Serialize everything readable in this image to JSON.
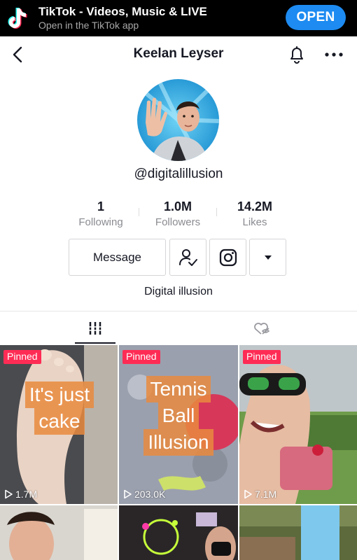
{
  "banner": {
    "title": "TikTok - Videos, Music & LIVE",
    "subtitle": "Open in the TikTok app",
    "open_label": "OPEN"
  },
  "nav": {
    "title": "Keelan Leyser",
    "icons": [
      "back-arrow-icon",
      "bell-icon",
      "more-icon"
    ]
  },
  "profile": {
    "username": "@digitalillusion",
    "bio": "Digital illusion"
  },
  "stats": [
    {
      "value": "1",
      "label": "Following"
    },
    {
      "value": "1.0M",
      "label": "Followers"
    },
    {
      "value": "14.2M",
      "label": "Likes"
    }
  ],
  "actions": {
    "message_label": "Message",
    "icons": [
      "follow-user-icon",
      "instagram-icon",
      "dropdown-caret-icon"
    ]
  },
  "tabs": [
    "videos-grid-icon",
    "liked-hidden-icon"
  ],
  "colors": {
    "accent": "#1d8bf1",
    "pinned": "#fe2c55",
    "text": "#161823",
    "muted": "#8a8b91"
  },
  "videos": [
    {
      "pinned": "Pinned",
      "views": "1.7M",
      "overlay": [
        "It's just",
        "cake"
      ]
    },
    {
      "pinned": "Pinned",
      "views": "203.0K",
      "overlay": [
        "Tennis",
        "Ball",
        "Illusion"
      ]
    },
    {
      "pinned": "Pinned",
      "views": "7.1M",
      "overlay": []
    },
    {
      "pinned": "",
      "views": "",
      "overlay": []
    },
    {
      "pinned": "",
      "views": "",
      "overlay": []
    },
    {
      "pinned": "",
      "views": "",
      "overlay": []
    }
  ]
}
